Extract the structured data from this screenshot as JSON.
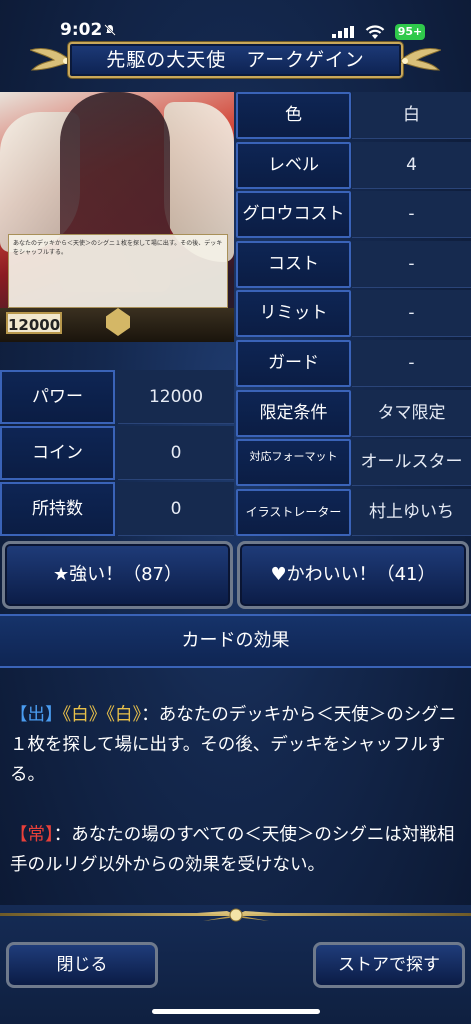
{
  "status_bar": {
    "time": "9:02",
    "battery": "95+"
  },
  "title": "先駆の大天使　アークゲイン",
  "card": {
    "power": "12000",
    "rules_text": "あなたのデッキから＜天使＞のシグニ１枚を探して場に出す。その後、デッキをシャッフルする。"
  },
  "stats": [
    {
      "label": "色",
      "value": "白"
    },
    {
      "label": "レベル",
      "value": "4"
    },
    {
      "label": "グロウコスト",
      "value": "-"
    },
    {
      "label": "コスト",
      "value": "-"
    },
    {
      "label": "リミット",
      "value": "-"
    },
    {
      "label": "ガード",
      "value": "-"
    },
    {
      "label": "限定条件",
      "value": "タマ限定"
    },
    {
      "label": "対応フォーマット",
      "value": "オールスター"
    },
    {
      "label": "イラストレーター",
      "value": "村上ゆいち"
    }
  ],
  "left_stats": [
    {
      "label": "パワー",
      "value": "12000"
    },
    {
      "label": "コイン",
      "value": "0"
    },
    {
      "label": "所持数",
      "value": "0"
    }
  ],
  "votes": {
    "strong": "★強い！（87）",
    "cute": "♥かわいい！（41）"
  },
  "effect": {
    "header": "カードの効果",
    "p1_tag": "【出】",
    "p1_cost": "《白》《白》",
    "p1_text": "：あなたのデッキから＜天使＞のシグニ１枚を探して場に出す。その後、デッキをシャッフルする。",
    "p2_tag": "【常】",
    "p2_text": "：あなたの場のすべての＜天使＞のシグニは対戦相手のルリグ以外からの効果を受けない。"
  },
  "buttons": {
    "close": "閉じる",
    "store": "ストアで探す"
  },
  "colors": {
    "accent_gold": "#c9a85a",
    "border_blue": "#3a63b8",
    "keyword_blue": "#4a9cf0",
    "keyword_gold": "#e8c04a",
    "keyword_red": "#e8403a"
  }
}
